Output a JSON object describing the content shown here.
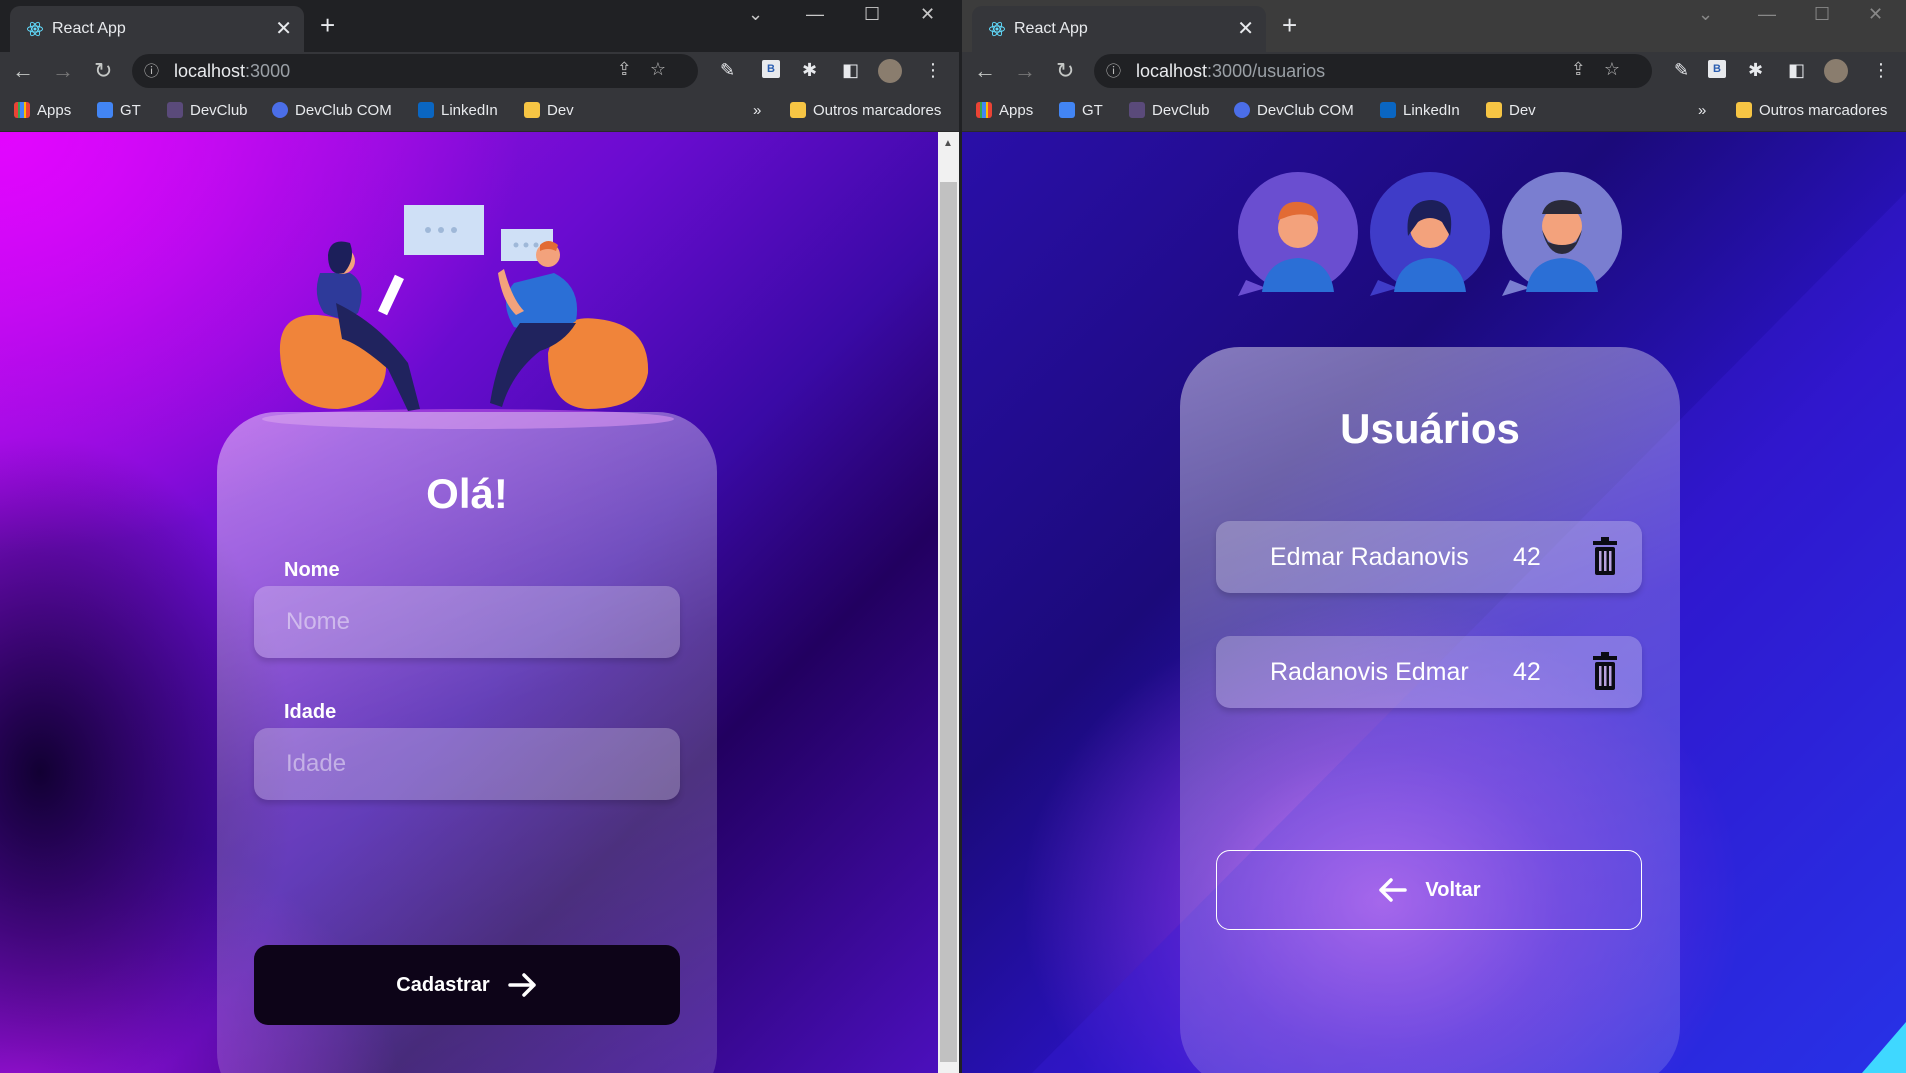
{
  "left_window": {
    "tab_title": "React App",
    "url_host": "localhost",
    "url_path": ":3000",
    "bookmarks": [
      "Apps",
      "GT",
      "DevClub",
      "DevClub COM",
      "LinkedIn",
      "Dev"
    ],
    "bookmarks_more": "»",
    "other_bookmarks": "Outros marcadores",
    "form": {
      "title": "Olá!",
      "name_label": "Nome",
      "name_placeholder": "Nome",
      "age_label": "Idade",
      "age_placeholder": "Idade",
      "submit_label": "Cadastrar",
      "submit_icon": "arrow-right-icon"
    }
  },
  "right_window": {
    "tab_title": "React App",
    "url_host": "localhost",
    "url_path": ":3000/usuarios",
    "bookmarks": [
      "Apps",
      "GT",
      "DevClub",
      "DevClub COM",
      "LinkedIn",
      "Dev"
    ],
    "bookmarks_more": "»",
    "other_bookmarks": "Outros marcadores",
    "users": {
      "title": "Usuários",
      "list": [
        {
          "name": "Edmar Radanovis",
          "age": "42",
          "icon": "trash-icon"
        },
        {
          "name": "Radanovis Edmar",
          "age": "42",
          "icon": "trash-icon"
        }
      ],
      "back_label": "Voltar",
      "back_icon": "arrow-left-icon"
    }
  },
  "colors": {
    "chrome_dark": "#202124",
    "chrome_toolbar": "#35363a",
    "button_dark": "#0d0418",
    "text": "#ffffff"
  }
}
